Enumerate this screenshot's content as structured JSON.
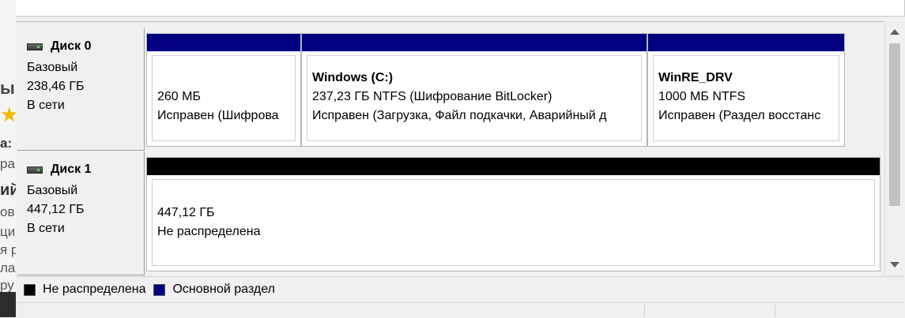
{
  "colors": {
    "primary_partition": "#000080",
    "unallocated": "#000000"
  },
  "background_window": {
    "fragments": [
      "ы",
      "а:",
      "ра",
      "ий",
      "ов",
      "ци",
      "я р",
      "ла",
      "ру"
    ]
  },
  "disks": [
    {
      "name": "Диск 0",
      "type": "Базовый",
      "size": "238,46 ГБ",
      "status": "В сети",
      "partitions": [
        {
          "label": "",
          "size": "260 МБ",
          "status": "Исправен (Шифрова"
        },
        {
          "label": "Windows  (C:)",
          "size": "237,23 ГБ NTFS (Шифрование BitLocker)",
          "status": "Исправен (Загрузка, Файл подкачки, Аварийный д"
        },
        {
          "label": "WinRE_DRV",
          "size": "1000 МБ NTFS",
          "status": "Исправен (Раздел восстанс"
        }
      ]
    },
    {
      "name": "Диск 1",
      "type": "Базовый",
      "size": "447,12 ГБ",
      "status": "В сети",
      "partitions": [
        {
          "size": "447,12 ГБ",
          "status": "Не распределена"
        }
      ]
    }
  ],
  "legend": {
    "unallocated_label": "Не распределена",
    "primary_label": "Основной раздел"
  }
}
